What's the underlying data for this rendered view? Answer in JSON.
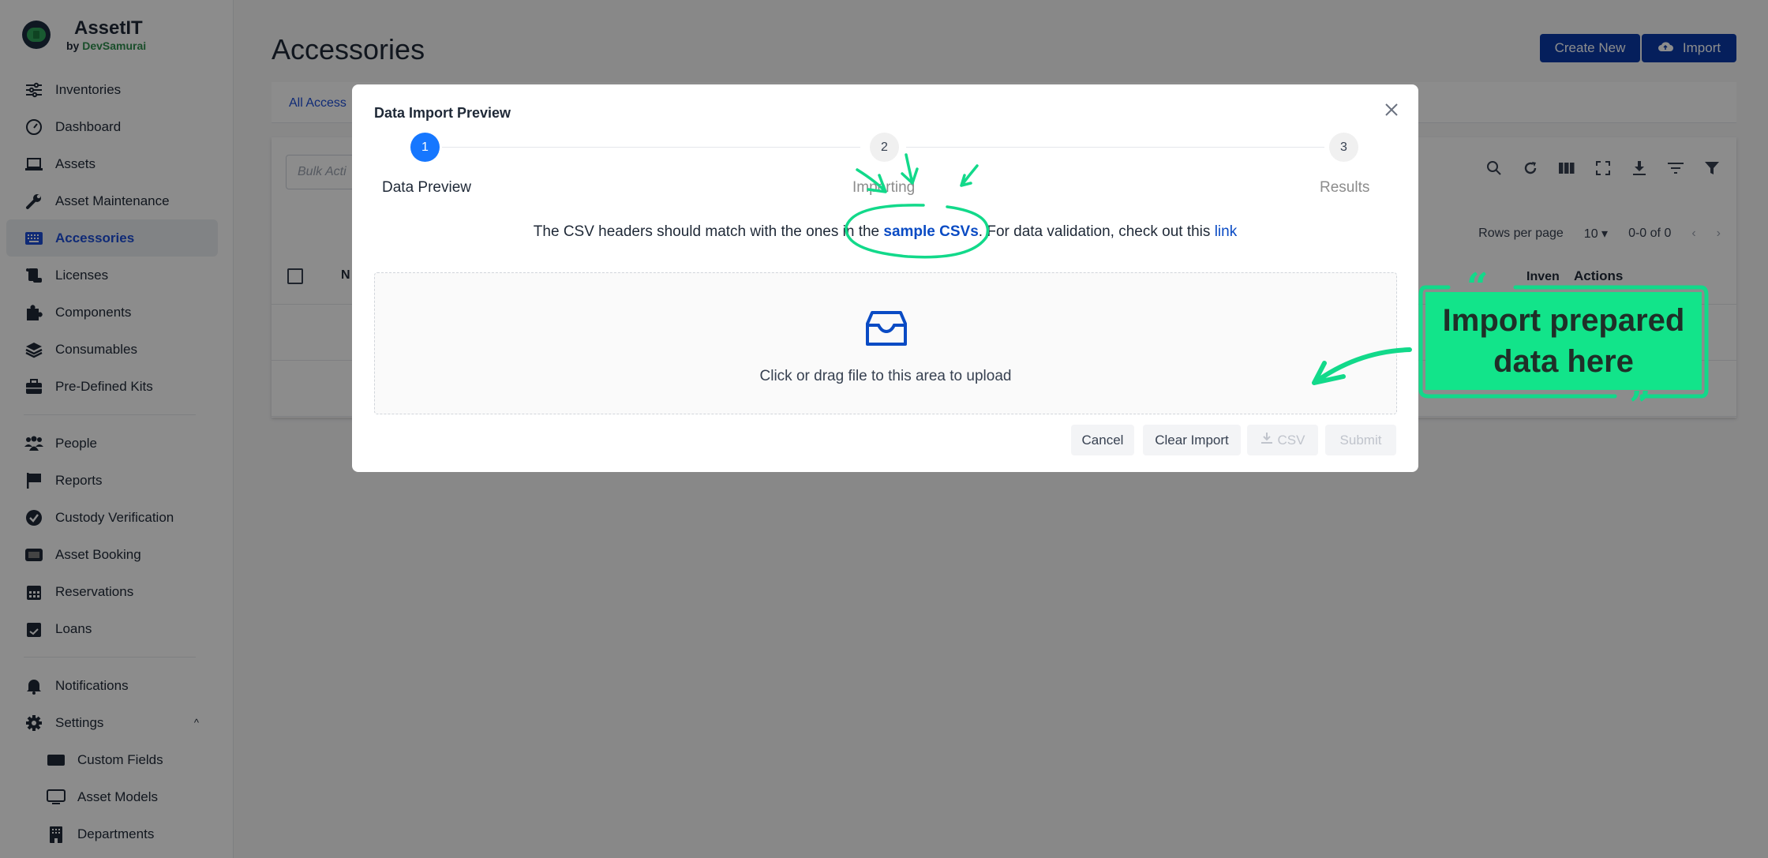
{
  "brand": {
    "name": "AssetIT",
    "by": "by",
    "org": "DevSamurai"
  },
  "sidebar": {
    "items": [
      {
        "label": "Inventories",
        "icon": "sliders-icon"
      },
      {
        "label": "Dashboard",
        "icon": "gauge-icon"
      },
      {
        "label": "Assets",
        "icon": "laptop-icon"
      },
      {
        "label": "Asset Maintenance",
        "icon": "wrench-icon"
      },
      {
        "label": "Accessories",
        "icon": "keyboard-icon",
        "active": true
      },
      {
        "label": "Licenses",
        "icon": "scroll-icon"
      },
      {
        "label": "Components",
        "icon": "puzzle-icon"
      },
      {
        "label": "Consumables",
        "icon": "layers-icon"
      },
      {
        "label": "Pre-Defined Kits",
        "icon": "toolbox-icon"
      }
    ],
    "items2": [
      {
        "label": "People",
        "icon": "people-icon"
      },
      {
        "label": "Reports",
        "icon": "flag-icon"
      },
      {
        "label": "Custody Verification",
        "icon": "badge-check-icon"
      },
      {
        "label": "Asset Booking",
        "icon": "ticket-icon"
      },
      {
        "label": "Reservations",
        "icon": "calendar-grid-icon"
      },
      {
        "label": "Loans",
        "icon": "calendar-check-icon"
      }
    ],
    "items3": [
      {
        "label": "Notifications",
        "icon": "bell-icon"
      },
      {
        "label": "Settings",
        "icon": "gear-icon",
        "expanded": true
      }
    ],
    "settings_children": [
      {
        "label": "Custom Fields",
        "icon": "credit-card-icon"
      },
      {
        "label": "Asset Models",
        "icon": "monitor-icon"
      },
      {
        "label": "Departments",
        "icon": "building-icon"
      }
    ]
  },
  "main": {
    "title": "Accessories",
    "create_new": "Create New",
    "import": "Import",
    "tab": "All Access",
    "bulk_actions_placeholder": "Bulk Acti",
    "rows_per_page_label": "Rows per page",
    "rows_per_page_value": "10",
    "range": "0-0 of 0",
    "columns": {
      "first": "N",
      "inventory": "Inven",
      "actions": "Actions"
    }
  },
  "modal": {
    "title": "Data Import Preview",
    "steps": [
      {
        "number": "1",
        "label": "Data Preview",
        "state": "active"
      },
      {
        "number": "2",
        "label": "Importing",
        "state": "pending"
      },
      {
        "number": "3",
        "label": "Results",
        "state": "pending"
      }
    ],
    "hint_prefix": "The CSV headers should match with the ones in the ",
    "hint_link1": "sample CSVs",
    "hint_mid": ". For data validation, check out this ",
    "hint_link2": "link",
    "dropzone_text": "Click or drag file to this area to upload",
    "buttons": {
      "cancel": "Cancel",
      "clear": "Clear Import",
      "csv": "CSV",
      "submit": "Submit"
    }
  },
  "annotation": {
    "callout_line1": "Import prepared",
    "callout_line2": "data here",
    "color": "#12e48a"
  }
}
